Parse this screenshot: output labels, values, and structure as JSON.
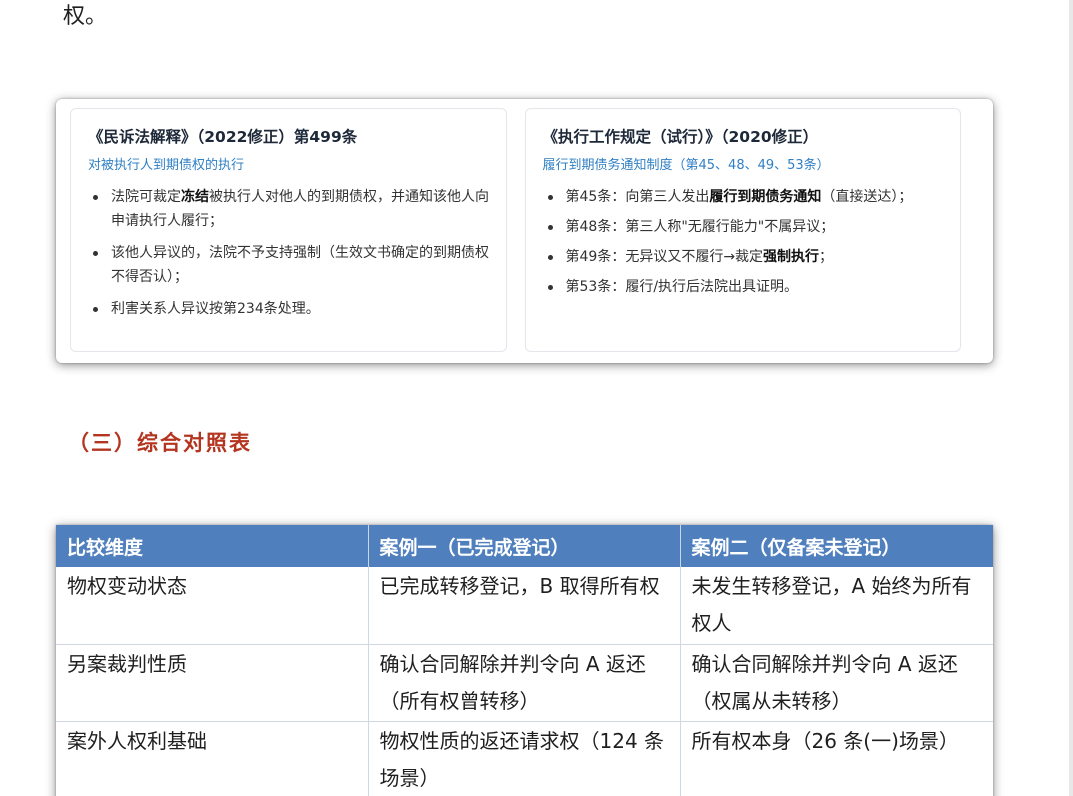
{
  "intro": {
    "tail_text": "权。"
  },
  "cards": [
    {
      "title": "《民诉法解释》（2022修正）第499条",
      "subtitle": "对被执行人到期债权的执行",
      "items": [
        {
          "pre": "法院可裁定",
          "bold": "冻结",
          "post": "被执行人对他人的到期债权，并通知该他人向申请执行人履行；"
        },
        {
          "pre": "该他人异议的，法院不予支持强制（生效文书确定的到期债权不得否认）；",
          "bold": "",
          "post": ""
        },
        {
          "pre": "利害关系人异议按第234条处理。",
          "bold": "",
          "post": ""
        }
      ]
    },
    {
      "title": "《执行工作规定（试行）》（2020修正）",
      "subtitle": "履行到期债务通知制度（第45、48、49、53条）",
      "items": [
        {
          "pre": "第45条：向第三人发出",
          "bold": "履行到期债务通知",
          "post": "（直接送达）；"
        },
        {
          "pre": "第48条：第三人称\"无履行能力\"不属异议；",
          "bold": "",
          "post": ""
        },
        {
          "pre": "第49条：无异议又不履行→裁定",
          "bold": "强制执行",
          "post": "；"
        },
        {
          "pre": "第53条：履行/执行后法院出具证明。",
          "bold": "",
          "post": ""
        }
      ]
    }
  ],
  "section": {
    "heading": "（三）综合对照表"
  },
  "table": {
    "headers": [
      "比较维度",
      "案例一（已完成登记）",
      "案例二（仅备案未登记）"
    ],
    "rows": [
      [
        "物权变动状态",
        "已完成转移登记，B 取得所有权",
        "未发生转移登记，A 始终为所有权人"
      ],
      [
        "另案裁判性质",
        "确认合同解除并判令向 A 返还（所有权曾转移）",
        "确认合同解除并判令向 A 返还（权属从未转移）"
      ],
      [
        "案外人权利基础",
        "物权性质的返还请求权（124 条场景）",
        "所有权本身（26 条(一)场景）"
      ]
    ]
  }
}
